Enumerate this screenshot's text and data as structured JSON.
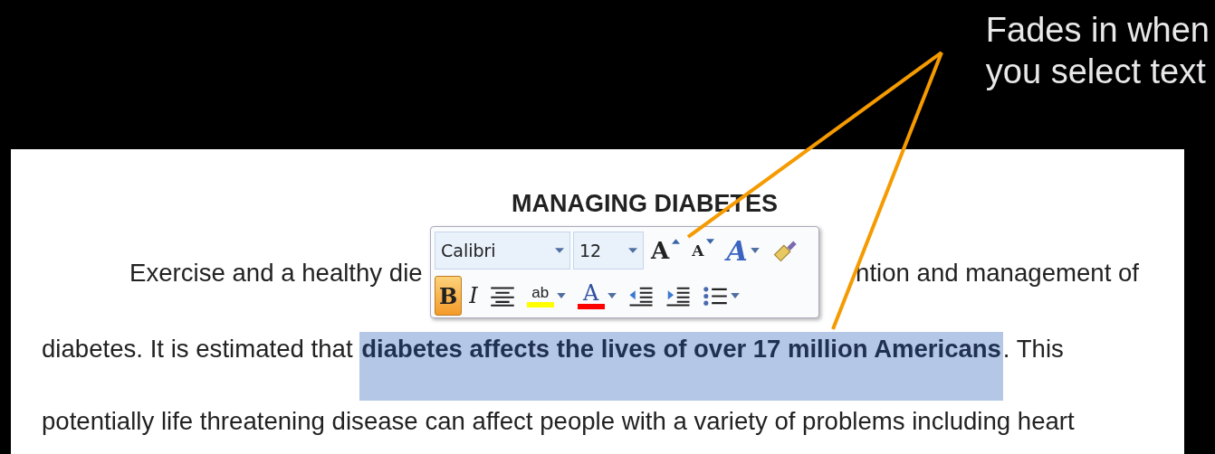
{
  "callout": {
    "lines": [
      "Fades in when",
      "you select text"
    ]
  },
  "document": {
    "heading": "MANAGING DIABETES",
    "line_1": {
      "left": "Exercise and a healthy die",
      "right": "ntion and management of"
    },
    "line_2": {
      "before": "diabetes. It is estimated that ",
      "selected_text": "diabetes affects the lives of over 17 million Americans",
      "after": ". This"
    },
    "line_3": "potentially life threatening disease can affect people with a variety of problems including heart"
  },
  "mini_toolbar": {
    "font": "Calibri",
    "size": "12",
    "row_1": [
      {
        "kind": "grow-font",
        "label": "A",
        "on": false
      },
      {
        "kind": "shrink-font",
        "label": "A",
        "on": false
      },
      {
        "kind": "styles",
        "label": "A",
        "on": false,
        "dropdown": true
      },
      {
        "kind": "format-painter",
        "on": false
      }
    ],
    "row_2": [
      {
        "kind": "bold",
        "label": "B",
        "on": true
      },
      {
        "kind": "italic",
        "label": "I",
        "on": false
      },
      {
        "kind": "center",
        "on": false
      },
      {
        "kind": "highlight",
        "label": "ab",
        "on": false,
        "dropdown": true,
        "color": "#ffff00"
      },
      {
        "kind": "font-color",
        "label": "A",
        "on": false,
        "dropdown": true,
        "color": "#ff0000"
      },
      {
        "kind": "decrease-indent",
        "on": false
      },
      {
        "kind": "increase-indent",
        "on": false
      },
      {
        "kind": "bullets",
        "on": false,
        "dropdown": true
      }
    ]
  }
}
